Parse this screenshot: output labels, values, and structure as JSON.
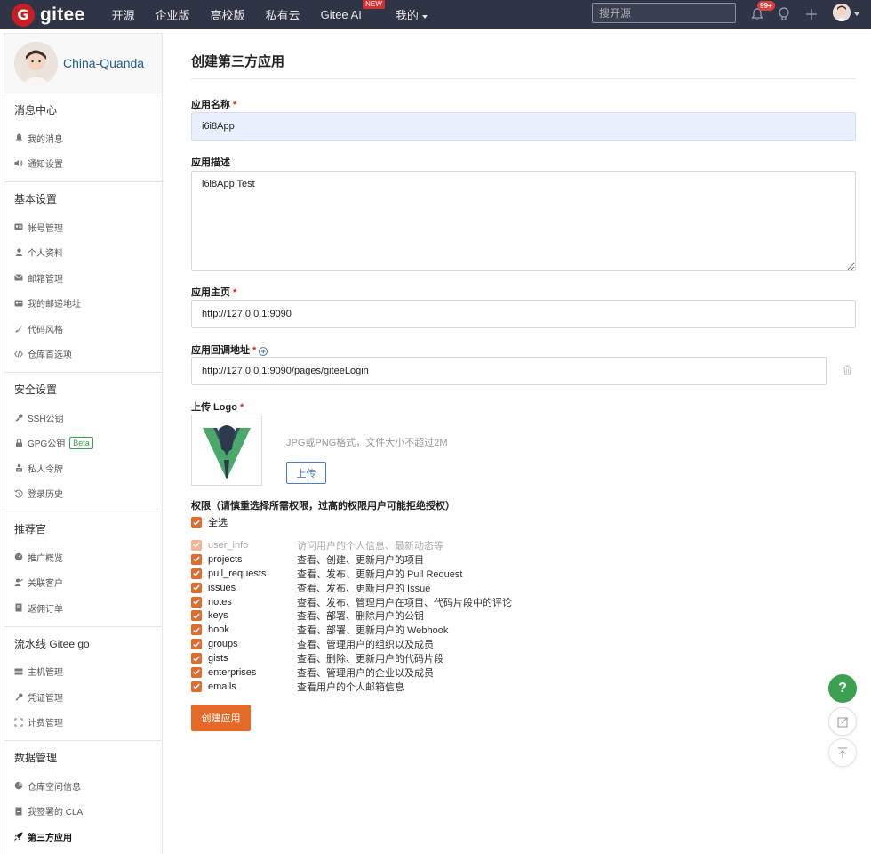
{
  "nav": {
    "logo_text": "gitee",
    "logo_letter": "G",
    "links": [
      "开源",
      "企业版",
      "高校版",
      "私有云",
      "Gitee AI",
      "我的"
    ],
    "new_badge": "NEW",
    "search_placeholder": "搜开源",
    "notification_count": "99+"
  },
  "sidebar": {
    "username": "China-Quanda",
    "sections": [
      {
        "title": "消息中心",
        "items": [
          {
            "label": "我的消息",
            "icon": "bell-icon"
          },
          {
            "label": "通知设置",
            "icon": "speaker-icon"
          }
        ]
      },
      {
        "title": "基本设置",
        "items": [
          {
            "label": "帐号管理",
            "icon": "id-card-icon"
          },
          {
            "label": "个人资料",
            "icon": "user-icon"
          },
          {
            "label": "邮箱管理",
            "icon": "mail-icon"
          },
          {
            "label": "我的邮递地址",
            "icon": "address-card-icon"
          },
          {
            "label": "代码风格",
            "icon": "brush-icon"
          },
          {
            "label": "仓库首选项",
            "icon": "code-icon"
          }
        ]
      },
      {
        "title": "安全设置",
        "items": [
          {
            "label": "SSH公钥",
            "icon": "key-icon"
          },
          {
            "label": "GPG公钥",
            "icon": "lock-icon",
            "badge": "Beta"
          },
          {
            "label": "私人令牌",
            "icon": "token-icon"
          },
          {
            "label": "登录历史",
            "icon": "history-icon"
          }
        ]
      },
      {
        "title": "推荐官",
        "items": [
          {
            "label": "推广概览",
            "icon": "dashboard-icon"
          },
          {
            "label": "关联客户",
            "icon": "user-link-icon"
          },
          {
            "label": "返佣订单",
            "icon": "order-icon"
          }
        ]
      },
      {
        "title": "流水线 Gitee go",
        "items": [
          {
            "label": "主机管理",
            "icon": "server-icon"
          },
          {
            "label": "凭证管理",
            "icon": "key-icon"
          },
          {
            "label": "计费管理",
            "icon": "billing-icon"
          }
        ]
      },
      {
        "title": "数据管理",
        "items": [
          {
            "label": "仓库空间信息",
            "icon": "pie-icon"
          },
          {
            "label": "我签署的 CLA",
            "icon": "document-icon"
          },
          {
            "label": "第三方应用",
            "icon": "rocket-icon",
            "active": true
          }
        ]
      }
    ]
  },
  "form": {
    "page_title": "创建第三方应用",
    "name_label": "应用名称",
    "name_value": "i6i8App",
    "desc_label": "应用描述",
    "desc_value": "i6i8App Test",
    "homepage_label": "应用主页",
    "homepage_value": "http://127.0.0.1:9090",
    "callback_label": "应用回调地址",
    "callback_value": "http://127.0.0.1:9090/pages/giteeLogin",
    "logo_label": "上传 Logo",
    "logo_hint": "JPG或PNG格式，文件大小不超过2M",
    "upload_label": "上传",
    "required_mark": "*",
    "permissions_title": "权限（请慎重选择所需权限，过高的权限用户可能拒绝授权）",
    "select_all_label": "全选",
    "permissions": [
      {
        "name": "user_info",
        "desc": "访问用户的个人信息、最新动态等",
        "disabled": true
      },
      {
        "name": "projects",
        "desc": "查看、创建、更新用户的项目"
      },
      {
        "name": "pull_requests",
        "desc": "查看、发布、更新用户的 Pull Request"
      },
      {
        "name": "issues",
        "desc": "查看、发布、更新用户的 Issue"
      },
      {
        "name": "notes",
        "desc": "查看、发布、管理用户在项目、代码片段中的评论"
      },
      {
        "name": "keys",
        "desc": "查看、部署、删除用户的公钥"
      },
      {
        "name": "hook",
        "desc": "查看、部署、更新用户的 Webhook"
      },
      {
        "name": "groups",
        "desc": "查看、管理用户的组织以及成员"
      },
      {
        "name": "gists",
        "desc": "查看、删除、更新用户的代码片段"
      },
      {
        "name": "enterprises",
        "desc": "查看、管理用户的企业以及成员"
      },
      {
        "name": "emails",
        "desc": "查看用户的个人邮箱信息"
      }
    ],
    "create_label": "创建应用"
  },
  "floating": {
    "help_label": "?"
  },
  "colors": {
    "nav_bg": "#2f3447",
    "brand_red": "#c71d23",
    "accent_orange": "#e46a2a",
    "link_blue": "#4c7bd9",
    "help_green": "#3ba04f"
  }
}
